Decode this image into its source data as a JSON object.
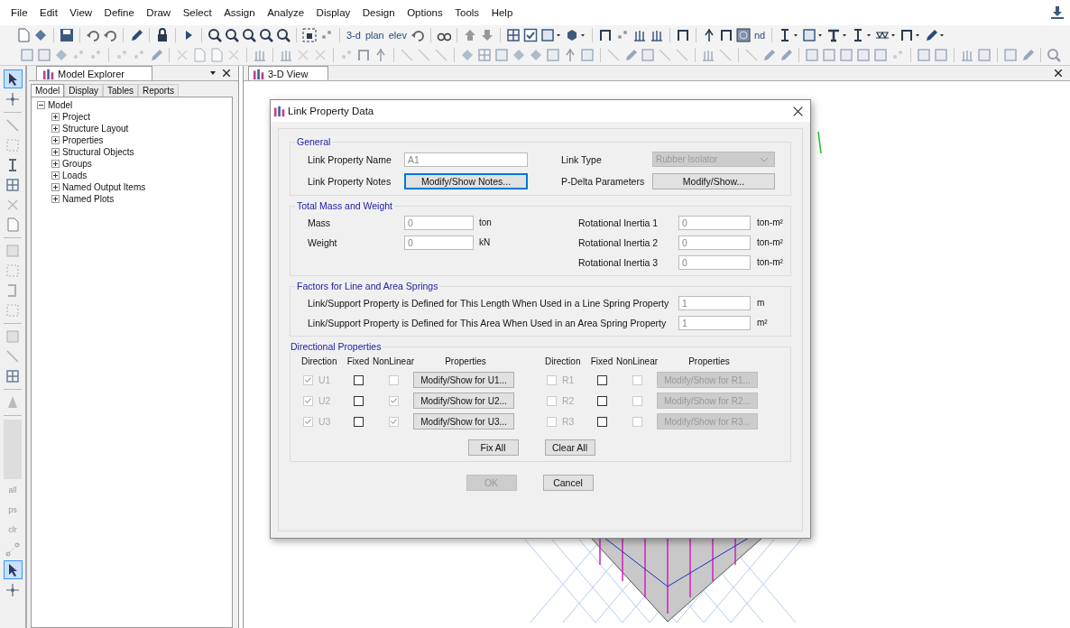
{
  "menu": [
    "File",
    "Edit",
    "View",
    "Define",
    "Draw",
    "Select",
    "Assign",
    "Analyze",
    "Display",
    "Design",
    "Options",
    "Tools",
    "Help"
  ],
  "toolbar_texts": [
    "3-d",
    "plan",
    "elev",
    "nd"
  ],
  "side_tools": [
    {
      "selected": true
    },
    {
      "selected": false
    },
    {
      "selected": false
    },
    {
      "selected": false
    },
    {
      "selected": false
    },
    {
      "selected": false
    },
    {
      "selected": false
    },
    {
      "selected": false
    },
    {
      "selected": false
    },
    {
      "selected": false
    },
    {
      "selected": false
    },
    {
      "selected": false
    },
    {
      "selected": false
    },
    {
      "selected": false
    },
    {
      "selected": false
    },
    {
      "selected": false
    },
    {
      "label": "all",
      "selected": false
    },
    {
      "label": "ps",
      "selected": false
    },
    {
      "label": "clr",
      "selected": false
    },
    {
      "selected": false
    },
    {
      "selected": true
    },
    {
      "selected": false
    }
  ],
  "explorer": {
    "title": "Model Explorer",
    "tabs": [
      {
        "label": "Model",
        "selected": true
      },
      {
        "label": "Display",
        "selected": false
      },
      {
        "label": "Tables",
        "selected": false
      },
      {
        "label": "Reports",
        "selected": false
      }
    ],
    "tree": [
      {
        "label": "Model",
        "expanded": true,
        "children": [
          {
            "label": "Project",
            "expanded": false
          },
          {
            "label": "Structure Layout",
            "expanded": false
          },
          {
            "label": "Properties",
            "expanded": false
          },
          {
            "label": "Structural Objects",
            "expanded": false
          },
          {
            "label": "Groups",
            "expanded": false
          },
          {
            "label": "Loads",
            "expanded": false
          },
          {
            "label": "Named Output Items",
            "expanded": false
          },
          {
            "label": "Named Plots",
            "expanded": false
          }
        ]
      }
    ]
  },
  "view_tab": "3-D View",
  "dialog": {
    "title": "Link Property Data",
    "general": {
      "title": "General",
      "name_label": "Link Property Name",
      "name_value": "A1",
      "notes_label": "Link Property Notes",
      "notes_button": "Modify/Show Notes...",
      "notes_focused": true,
      "type_label": "Link Type",
      "type_value": "Rubber Isolator",
      "type_disabled": true,
      "pdelta_label": "P-Delta Parameters",
      "pdelta_button": "Modify/Show..."
    },
    "mass": {
      "title": "Total Mass and Weight",
      "left": [
        {
          "label": "Mass",
          "value": "0",
          "unit": "ton"
        },
        {
          "label": "Weight",
          "value": "0",
          "unit": "kN"
        }
      ],
      "right": [
        {
          "label": "Rotational Inertia 1",
          "value": "0",
          "unit": "ton-m²"
        },
        {
          "label": "Rotational Inertia 2",
          "value": "0",
          "unit": "ton-m²"
        },
        {
          "label": "Rotational Inertia 3",
          "value": "0",
          "unit": "ton-m²"
        }
      ]
    },
    "springs": {
      "title": "Factors for Line and Area Springs",
      "rows": [
        {
          "label": "Link/Support Property is Defined for This Length When Used in a Line Spring Property",
          "value": "1",
          "unit": "m"
        },
        {
          "label": "Link/Support Property is Defined for This Area When Used in an Area Spring Property",
          "value": "1",
          "unit": "m²"
        }
      ]
    },
    "directional": {
      "title": "Directional Properties",
      "headers_left": [
        "Direction",
        "Fixed",
        "NonLinear",
        "Properties"
      ],
      "headers_right": [
        "Direction",
        "Fixed",
        "NonLinear",
        "Properties"
      ],
      "left": [
        {
          "dir": "U1",
          "dir_checked": true,
          "fixed_checked": false,
          "nonlinear_checked": false,
          "button": "Modify/Show for U1...",
          "button_disabled": false
        },
        {
          "dir": "U2",
          "dir_checked": true,
          "fixed_checked": false,
          "nonlinear_checked": true,
          "button": "Modify/Show for U2...",
          "button_disabled": false
        },
        {
          "dir": "U3",
          "dir_checked": true,
          "fixed_checked": false,
          "nonlinear_checked": true,
          "button": "Modify/Show for U3...",
          "button_disabled": false
        }
      ],
      "right": [
        {
          "dir": "R1",
          "dir_checked": false,
          "fixed_checked": false,
          "nonlinear_checked": false,
          "button": "Modify/Show for R1...",
          "button_disabled": true
        },
        {
          "dir": "R2",
          "dir_checked": false,
          "fixed_checked": false,
          "nonlinear_checked": false,
          "button": "Modify/Show for R2...",
          "button_disabled": true
        },
        {
          "dir": "R3",
          "dir_checked": false,
          "fixed_checked": false,
          "nonlinear_checked": false,
          "button": "Modify/Show for R3...",
          "button_disabled": true
        }
      ],
      "fix_all": "Fix All",
      "clear_all": "Clear All"
    },
    "ok": {
      "label": "OK",
      "disabled": true
    },
    "cancel": "Cancel"
  }
}
